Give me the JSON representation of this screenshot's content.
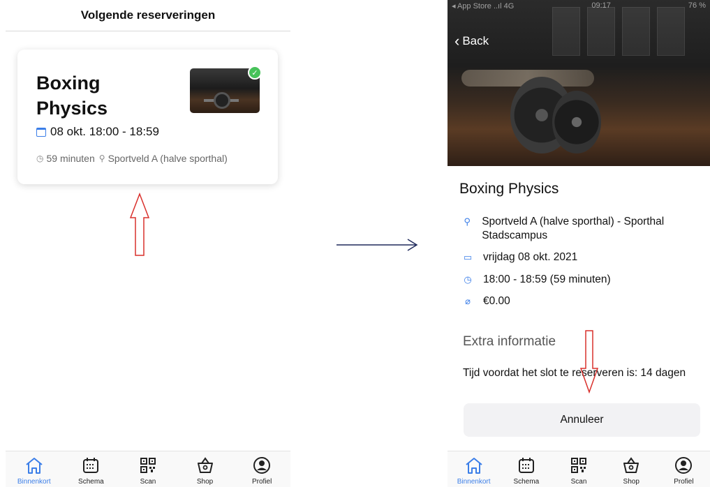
{
  "left": {
    "header_title": "Volgende reserveringen",
    "card": {
      "title": "Boxing Physics",
      "date_time": "08 okt. 18:00 - 18:59",
      "duration": "59 minuten",
      "location": "Sportveld A (halve sporthal)",
      "status": "confirmed"
    }
  },
  "right": {
    "back_label": "Back",
    "status_bar": {
      "carrier": "◂ App Store ..ıl 4G",
      "time": "09:17",
      "battery": "76 %"
    },
    "title": "Boxing Physics",
    "location": "Sportveld A (halve sporthal) - Sporthal Stadscampus",
    "date": "vrijdag 08 okt. 2021",
    "time": "18:00 - 18:59 (59 minuten)",
    "price": "€0.00",
    "extra_title": "Extra informatie",
    "extra_text": "Tijd voordat het slot te reserveren is: 14 dagen",
    "cancel_label": "Annuleer"
  },
  "tabbar": {
    "items": [
      {
        "label": "Binnenkort",
        "icon": "home-icon",
        "active": true
      },
      {
        "label": "Schema",
        "icon": "calendar-icon",
        "active": false
      },
      {
        "label": "Scan",
        "icon": "qr-code-icon",
        "active": false
      },
      {
        "label": "Shop",
        "icon": "basket-icon",
        "active": false
      },
      {
        "label": "Profiel",
        "icon": "profile-icon",
        "active": false
      }
    ]
  },
  "colors": {
    "accent": "#3b7ee8",
    "annotation_red": "#d9302c",
    "annotation_navy": "#1f2a5c",
    "check_green": "#47c25a"
  }
}
